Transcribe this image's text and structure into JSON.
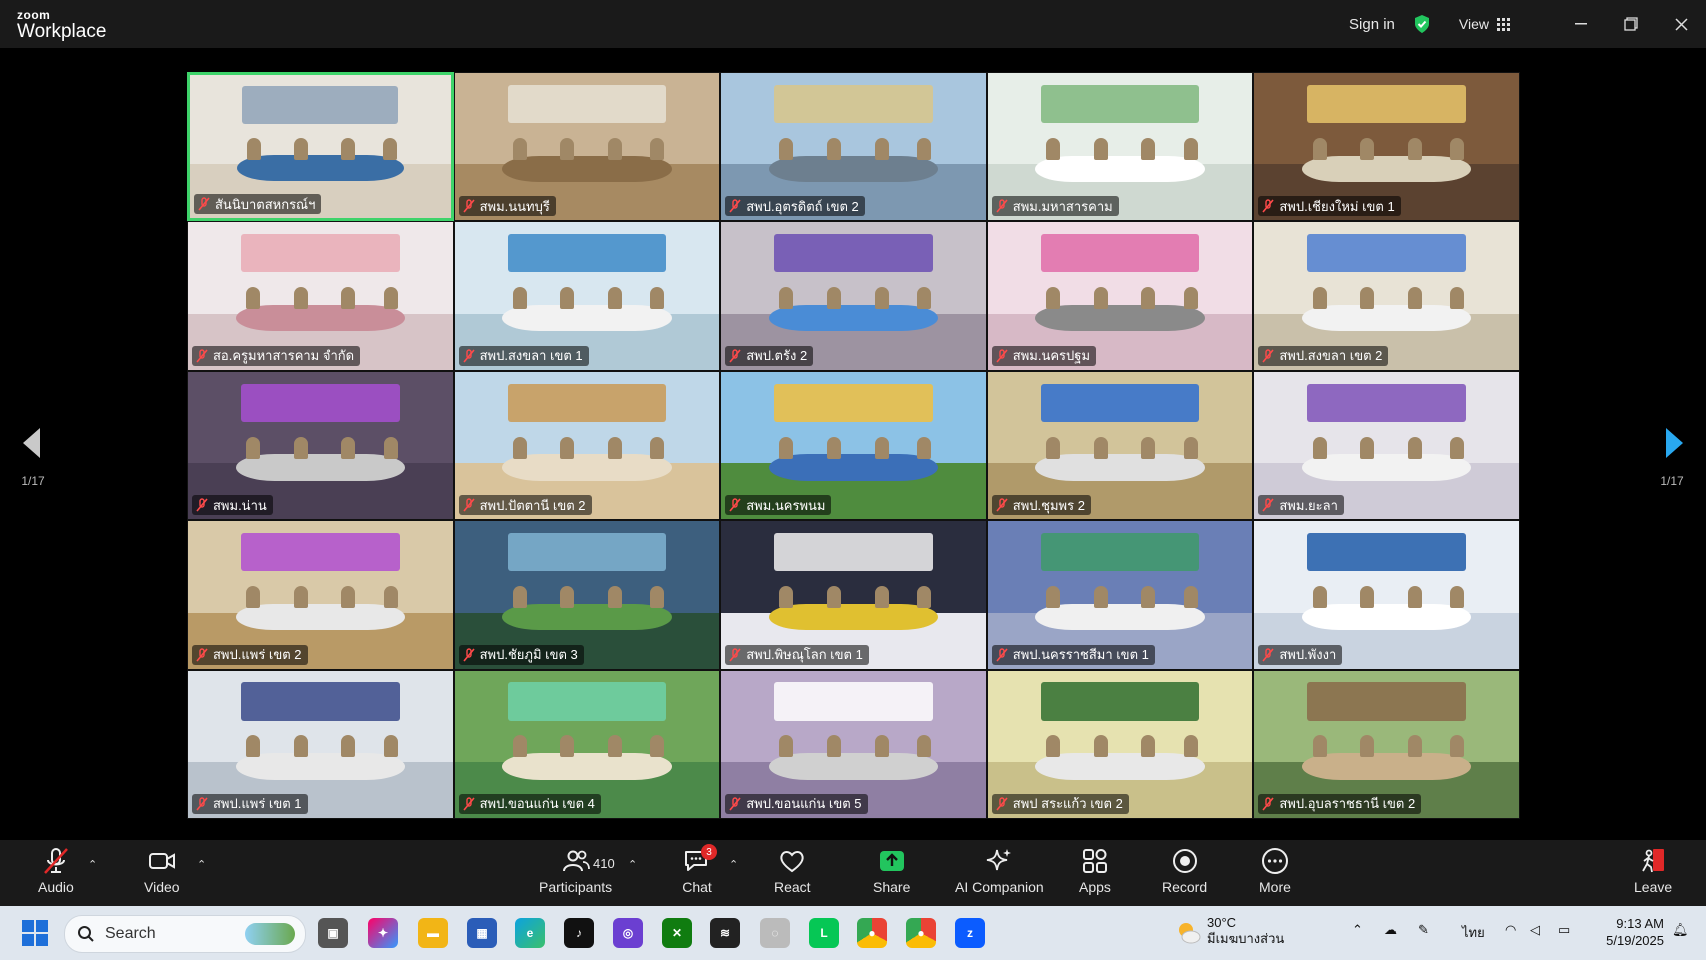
{
  "app": {
    "brand_small": "zoom",
    "brand_large": "Workplace"
  },
  "titlebar": {
    "sign_in": "Sign in",
    "view": "View"
  },
  "gallery": {
    "page_left": "1/17",
    "page_right": "1/17",
    "tiles": [
      {
        "name": "สันนิบาตสหกรณ์ฯ",
        "active": true
      },
      {
        "name": "สพม.นนทบุรี"
      },
      {
        "name": "สพป.อุตรดิตถ์ เขต 2"
      },
      {
        "name": "สพม.มหาสารคาม"
      },
      {
        "name": "สพป.เชียงใหม่ เขต 1"
      },
      {
        "name": "สอ.ครูมหาสารคาม จำกัด"
      },
      {
        "name": "สพป.สงขลา เขต 1"
      },
      {
        "name": "สพป.ตรัง 2"
      },
      {
        "name": "สพม.นครปฐม"
      },
      {
        "name": "สพป.สงขลา เขต 2"
      },
      {
        "name": "สพม.น่าน"
      },
      {
        "name": "สพป.ปัตตานี เขต 2"
      },
      {
        "name": "สพม.นครพนม"
      },
      {
        "name": "สพป.ชุมพร 2"
      },
      {
        "name": "สพม.ยะลา"
      },
      {
        "name": "สพป.แพร่ เขต 2"
      },
      {
        "name": "สพป.ชัยภูมิ เขต 3"
      },
      {
        "name": "สพป.พิษณุโลก เขต 1"
      },
      {
        "name": "สพป.นครราชสีมา เขต 1"
      },
      {
        "name": "สพป.พังงา"
      },
      {
        "name": "สพป.แพร่ เขต 1"
      },
      {
        "name": "สพป.ขอนแก่น เขต 4"
      },
      {
        "name": "สพป.ขอนแก่น เขต 5"
      },
      {
        "name": "สพป สระแก้ว เขต 2"
      },
      {
        "name": "สพป.อุบลราชธานี เขต 2"
      }
    ]
  },
  "toolbar": {
    "audio": "Audio",
    "video": "Video",
    "participants": "Participants",
    "participants_count": "410",
    "chat": "Chat",
    "chat_badge": "3",
    "react": "React",
    "share": "Share",
    "ai_companion": "AI Companion",
    "apps": "Apps",
    "record": "Record",
    "more": "More",
    "leave": "Leave"
  },
  "taskbar": {
    "search_placeholder": "Search",
    "temperature": "30°C",
    "weather_desc": "มีเมฆบางส่วน",
    "language": "ไทย",
    "time": "9:13 AM",
    "date": "5/19/2025"
  },
  "colors": {
    "accent_green": "#3ed36a",
    "share_green": "#22c55e",
    "taskbar_bg": "#dfe6ee"
  }
}
